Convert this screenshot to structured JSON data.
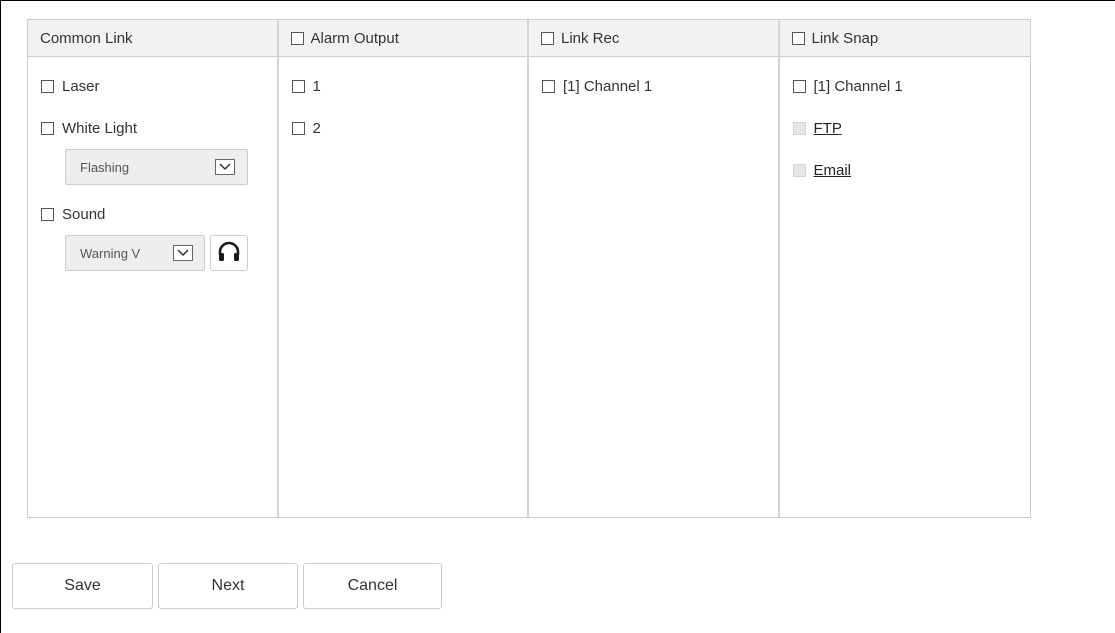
{
  "columns": {
    "common_link": {
      "header": "Common Link",
      "items": {
        "laser": "Laser",
        "white_light": "White Light",
        "white_light_mode": "Flashing",
        "sound": "Sound",
        "sound_mode": "Warning V"
      }
    },
    "alarm_output": {
      "header": "Alarm Output",
      "items": [
        "1",
        "2"
      ]
    },
    "link_rec": {
      "header": "Link Rec",
      "items": [
        "[1] Channel 1"
      ]
    },
    "link_snap": {
      "header": "Link Snap",
      "items": [
        "[1] Channel 1",
        "FTP",
        "Email"
      ]
    }
  },
  "buttons": {
    "save": "Save",
    "next": "Next",
    "cancel": "Cancel"
  },
  "icons": {
    "chevron": "chevron-down-icon",
    "audition": "headphones-icon"
  },
  "colors": {
    "header_bg": "#f2f2f2",
    "border": "#cccccc",
    "select_bg": "#eeeeee",
    "disabled_checkbox": "#e6e6e6"
  }
}
